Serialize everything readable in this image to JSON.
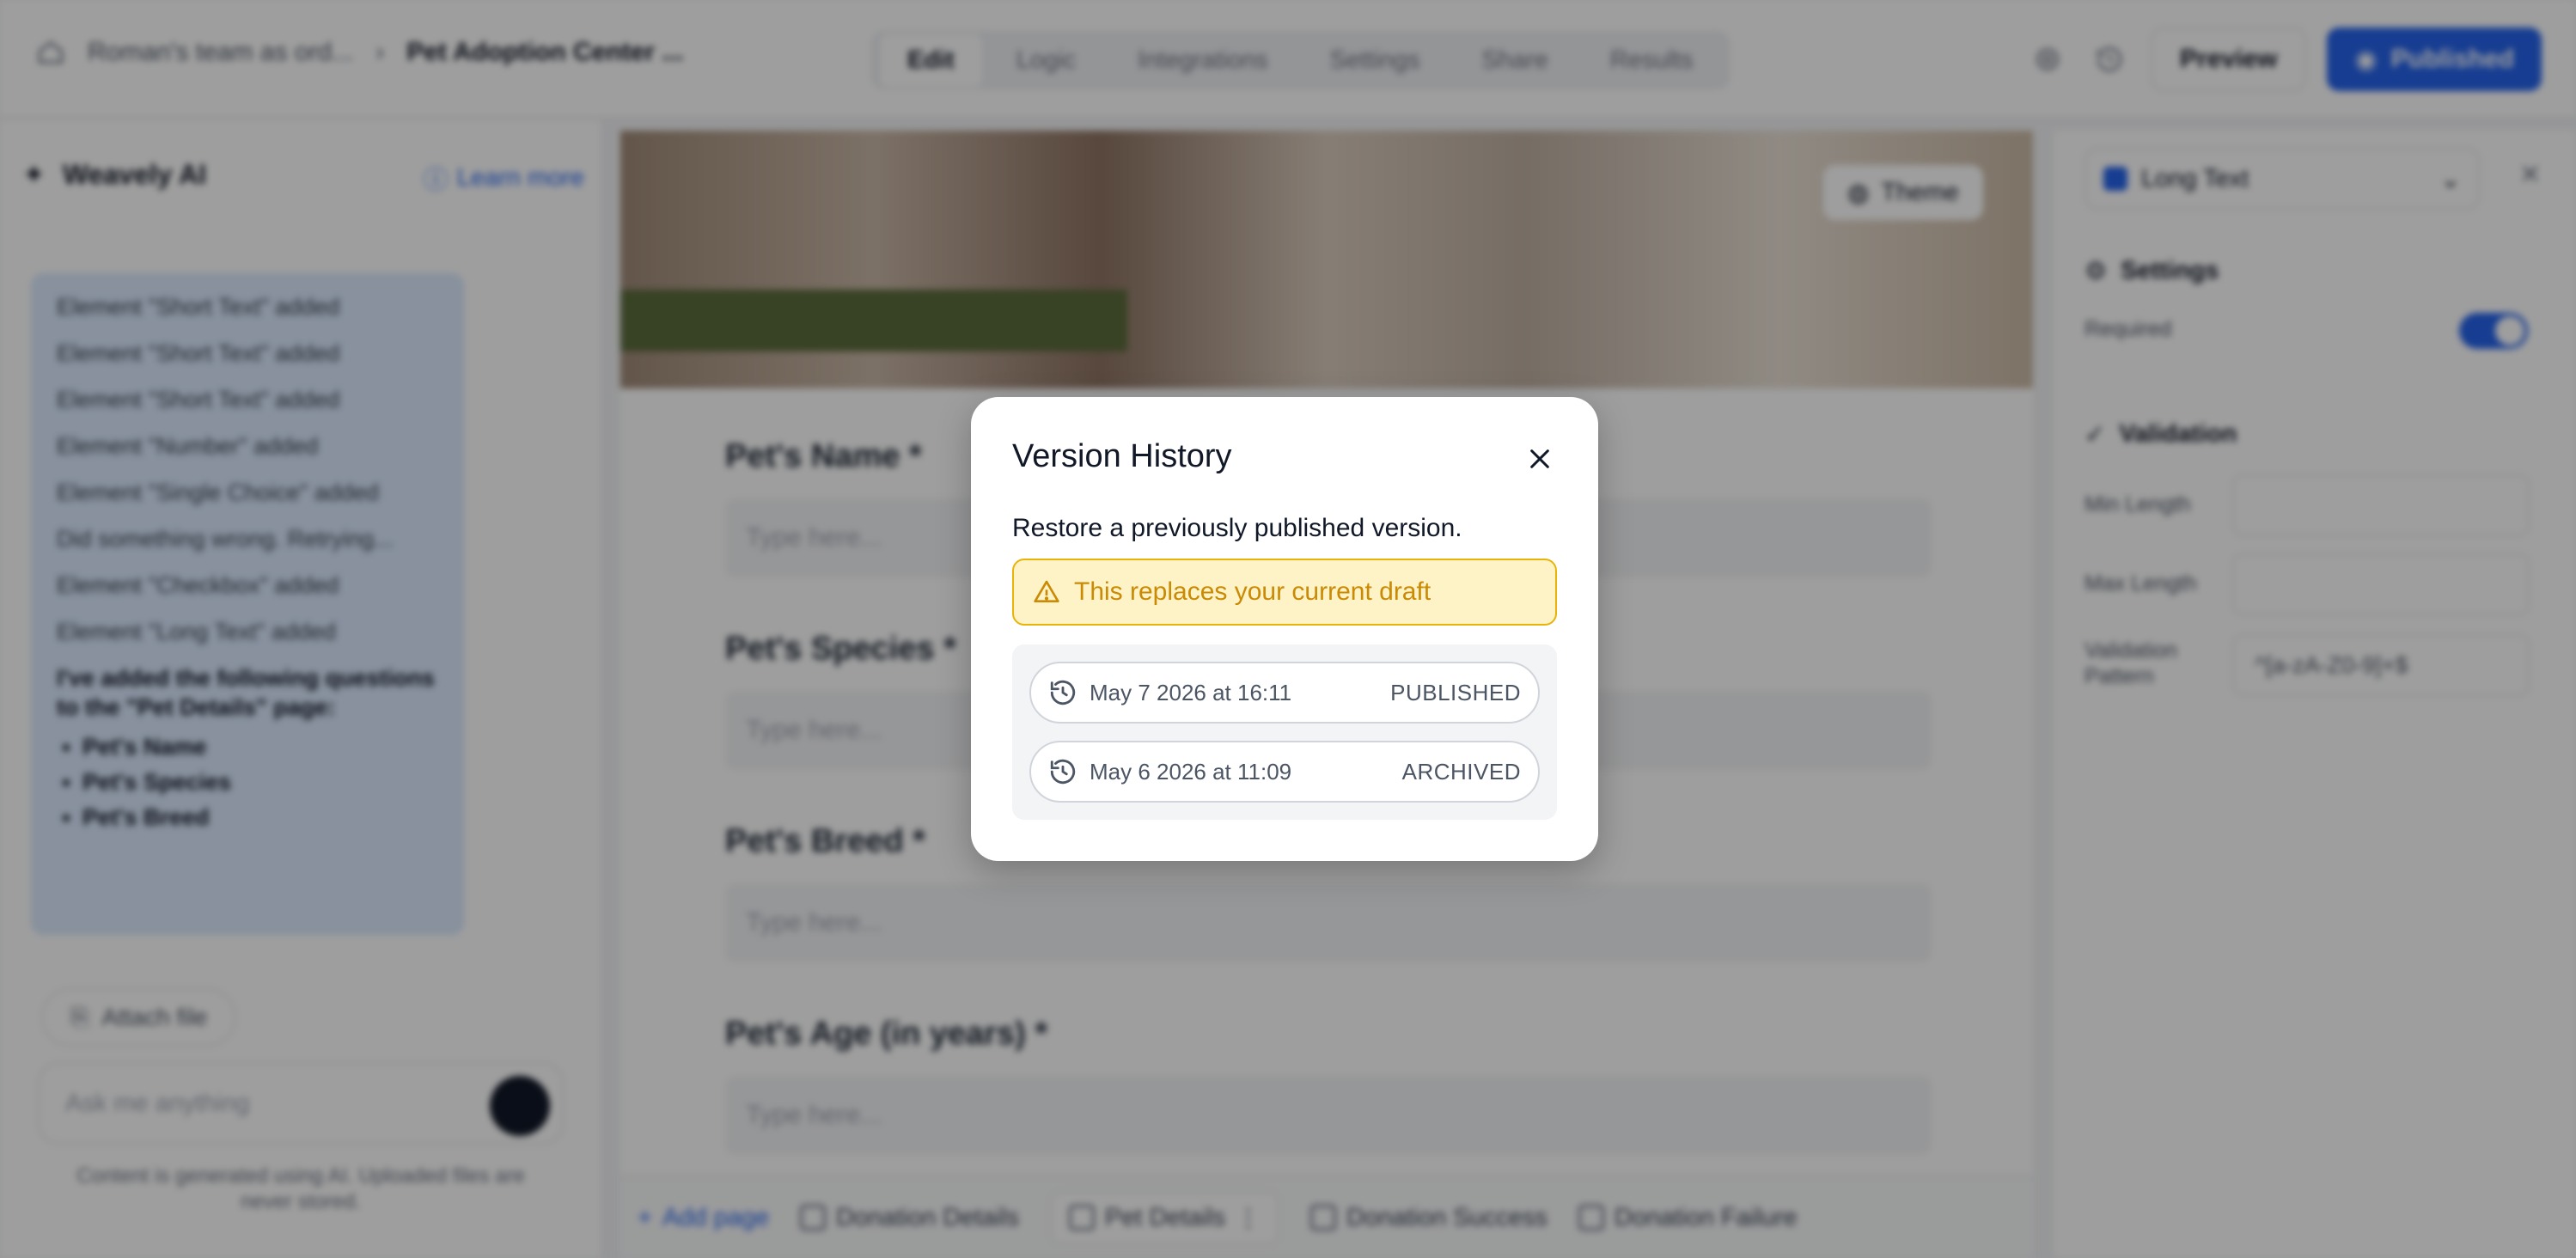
{
  "topbar": {
    "breadcrumb": [
      "Roman's team as ord...",
      "Pet Adoption Center ..."
    ],
    "tabs": [
      "Edit",
      "Logic",
      "Integrations",
      "Settings",
      "Share",
      "Results"
    ],
    "active_tab": "Edit",
    "preview_label": "Preview",
    "publish_label": "Published"
  },
  "left_panel": {
    "title": "Weavely AI",
    "learn_more": "Learn more",
    "chat_lines": [
      "Element \"Short Text\" added",
      "Element \"Short Text\" added",
      "Element \"Short Text\" added",
      "Element \"Number\" added",
      "Element \"Single Choice\" added",
      "Did something wrong. Retrying...",
      "Element \"Checkbox\" added",
      "Element \"Long Text\" added"
    ],
    "summary": "I've added the following questions to the \"Pet Details\" page:",
    "summary_items": [
      "Pet's Name",
      "Pet's Species",
      "Pet's Breed"
    ],
    "attach_label": "Attach file",
    "ask_placeholder": "Ask me anything",
    "disclaimer": "Content is generated using AI. Uploaded files are never stored."
  },
  "center": {
    "theme_label": "Theme",
    "questions": [
      {
        "label": "Pet's Name *",
        "placeholder": "Type here..."
      },
      {
        "label": "Pet's Species *",
        "placeholder": "Type here..."
      },
      {
        "label": "Pet's Breed *",
        "placeholder": "Type here..."
      },
      {
        "label": "Pet's Age (in years) *",
        "placeholder": "Type here..."
      }
    ],
    "pages": {
      "add": "Add page",
      "items": [
        "Donation Details",
        "Pet Details",
        "Donation Success",
        "Donation Failure"
      ]
    }
  },
  "right_panel": {
    "element_type": "Long Text",
    "settings_title": "Settings",
    "required_label": "Required",
    "validation_title": "Validation",
    "min_length_label": "Min Length",
    "max_length_label": "Max Length",
    "pattern_label": "Validation Pattern",
    "pattern_value": "^[a-zA-Z0-9]+$"
  },
  "modal": {
    "title": "Version History",
    "description": "Restore a previously published version.",
    "warning": "This replaces your current draft",
    "versions": [
      {
        "date": "May 7 2026 at 16:11",
        "status": "PUBLISHED"
      },
      {
        "date": "May 6 2026 at 11:09",
        "status": "ARCHIVED"
      }
    ]
  },
  "colors": {
    "accent": "#2563eb",
    "warning_bg": "#fef3c7",
    "warning_border": "#eab308",
    "warning_text": "#ca8a04"
  },
  "icons": [
    "home-icon",
    "chevron-right-icon",
    "gear-icon",
    "history-icon",
    "close-icon",
    "warning-icon",
    "sparkle-icon",
    "paperclip-icon"
  ]
}
